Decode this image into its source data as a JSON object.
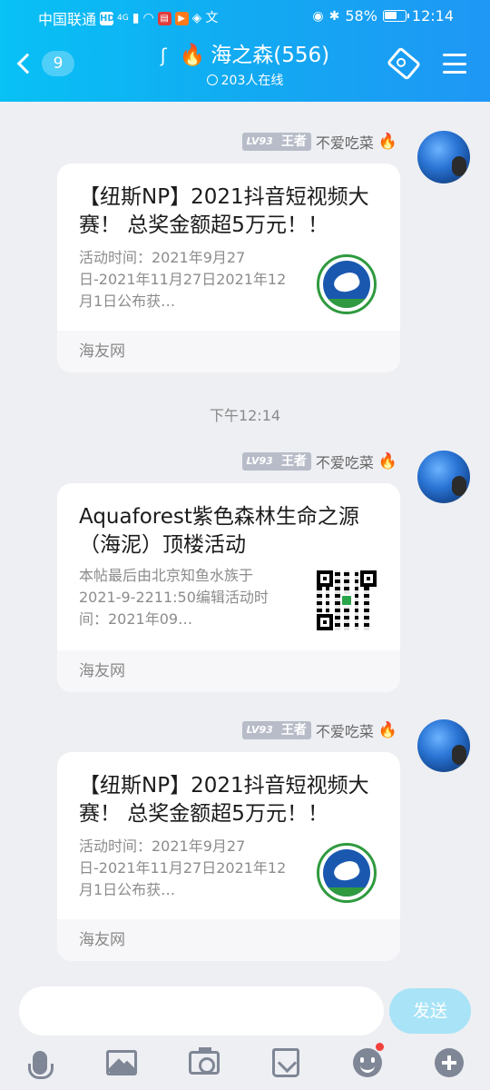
{
  "status_bar": {
    "carrier": "中国联通",
    "network_badge": "HD",
    "signal": "4G",
    "battery_percent": "58%",
    "time": "12:14"
  },
  "header": {
    "back_count": "9",
    "group_name": "海之森(556)",
    "online_text": "203人在线"
  },
  "messages": [
    {
      "sender": {
        "level": "LV93",
        "rank": "王者",
        "name": "不爱吃菜"
      },
      "card": {
        "title": "【纽斯NP】2021抖音短视频大赛！ 总奖金额超5万元！！",
        "description": "活动时间：2021年9月27日-2021年11月27日2021年12月1日公布获…",
        "source": "海友网",
        "thumb_icon": "green-circle-logo"
      }
    },
    {
      "timestamp": "下午12:14",
      "sender": {
        "level": "LV93",
        "rank": "王者",
        "name": "不爱吃菜"
      },
      "card": {
        "title": "Aquaforest紫色森林生命之源（海泥）顶楼活动",
        "description": "本帖最后由北京知鱼水族于2021-9-2211:50编辑活动时间：2021年09…",
        "source": "海友网",
        "thumb_icon": "qr-code"
      }
    },
    {
      "sender": {
        "level": "LV93",
        "rank": "王者",
        "name": "不爱吃菜"
      },
      "card": {
        "title": "【纽斯NP】2021抖音短视频大赛！ 总奖金额超5万元！！",
        "description": "活动时间：2021年9月27日-2021年11月27日2021年12月1日公布获…",
        "source": "海友网",
        "thumb_icon": "green-circle-logo"
      }
    }
  ],
  "input": {
    "value": "",
    "send_label": "发送"
  },
  "toolbar": [
    "mic-icon",
    "image-icon",
    "camera-icon",
    "red-packet-icon",
    "emoji-icon",
    "plus-icon"
  ],
  "colors": {
    "header_start": "#08c1f5",
    "header_end": "#1f97f5",
    "send_button": "#a8e3f7",
    "background": "#eeeff3"
  }
}
